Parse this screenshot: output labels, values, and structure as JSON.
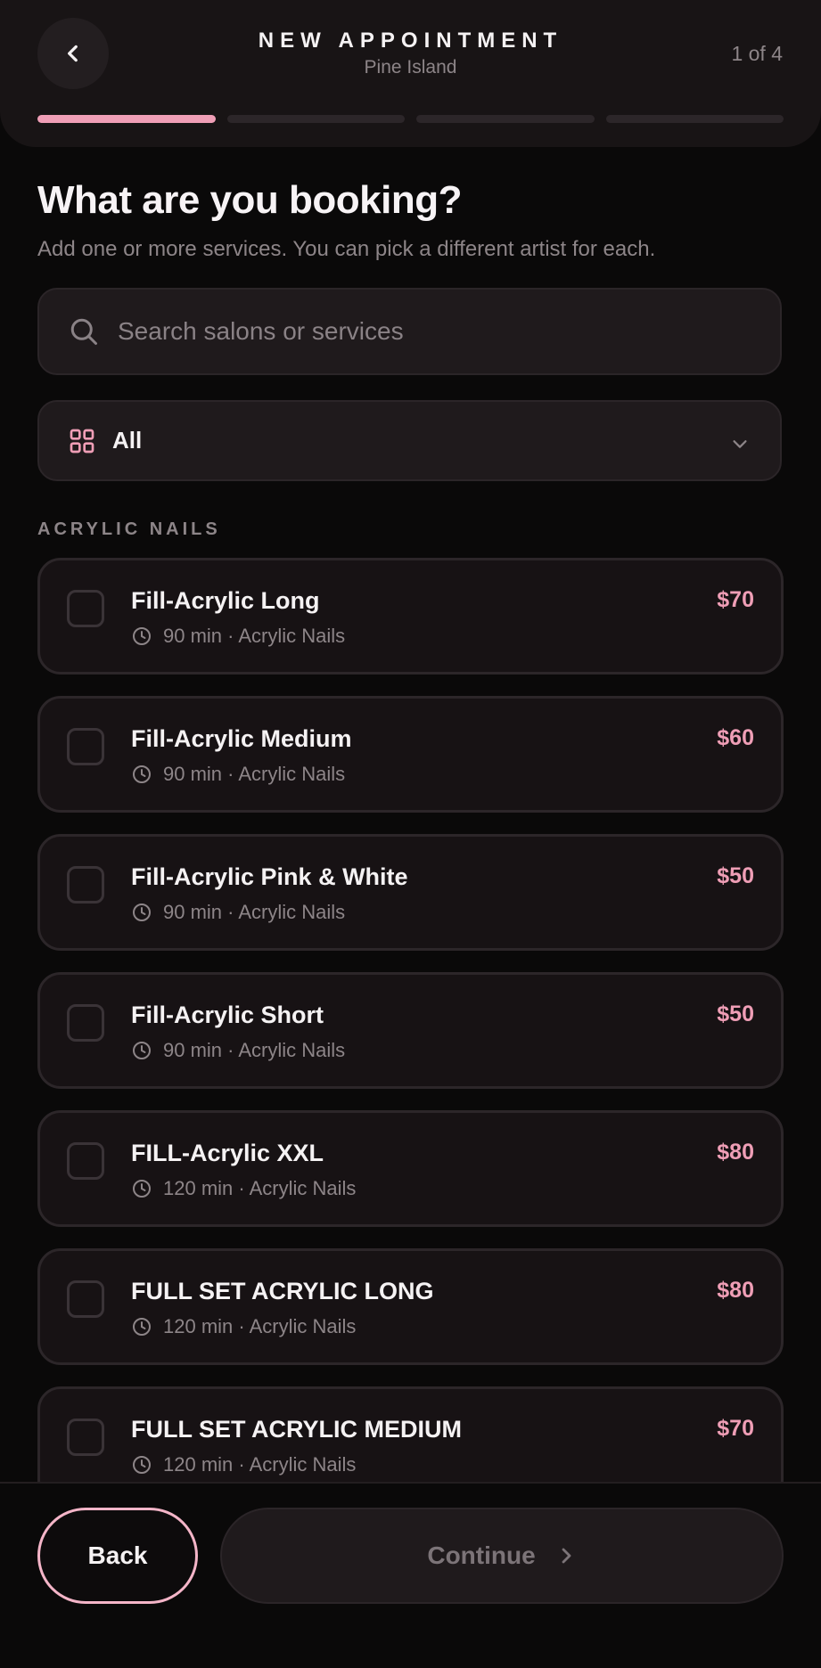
{
  "header": {
    "title": "NEW APPOINTMENT",
    "subtitle": "Pine Island",
    "step": "1 of 4",
    "progress": {
      "current": 1,
      "total": 4
    }
  },
  "page": {
    "title": "What are you booking?",
    "subtitle": "Add one or more services. You can pick a different artist for each."
  },
  "search": {
    "placeholder": "Search salons or services",
    "value": ""
  },
  "filter": {
    "selected": "All"
  },
  "section": {
    "label": "ACRYLIC NAILS"
  },
  "services": [
    {
      "name": "Fill-Acrylic Long",
      "meta": "90 min · Acrylic Nails",
      "price": "$70",
      "selected": false
    },
    {
      "name": "Fill-Acrylic Medium",
      "meta": "90 min · Acrylic Nails",
      "price": "$60",
      "selected": false
    },
    {
      "name": "Fill-Acrylic Pink & White",
      "meta": "90 min · Acrylic Nails",
      "price": "$50",
      "selected": false
    },
    {
      "name": "Fill-Acrylic Short",
      "meta": "90 min · Acrylic Nails",
      "price": "$50",
      "selected": false
    },
    {
      "name": "FILL-Acrylic XXL",
      "meta": "120 min · Acrylic Nails",
      "price": "$80",
      "selected": false
    },
    {
      "name": "FULL SET ACRYLIC LONG",
      "meta": "120 min · Acrylic Nails",
      "price": "$80",
      "selected": false
    },
    {
      "name": "FULL SET ACRYLIC MEDIUM",
      "meta": "120 min · Acrylic Nails",
      "price": "$70",
      "selected": false
    }
  ],
  "footer": {
    "back_label": "Back",
    "continue_label": "Continue"
  },
  "colors": {
    "accent": "#ef9eb6",
    "background": "#0a0909",
    "surface": "#1f1a1c",
    "card": "#171214"
  },
  "icons": {
    "back": "chevron-left-icon",
    "search": "search-icon",
    "filter": "grid-icon",
    "dropdown": "chevron-down-icon",
    "duration": "clock-icon",
    "continue": "chevron-right-icon"
  }
}
